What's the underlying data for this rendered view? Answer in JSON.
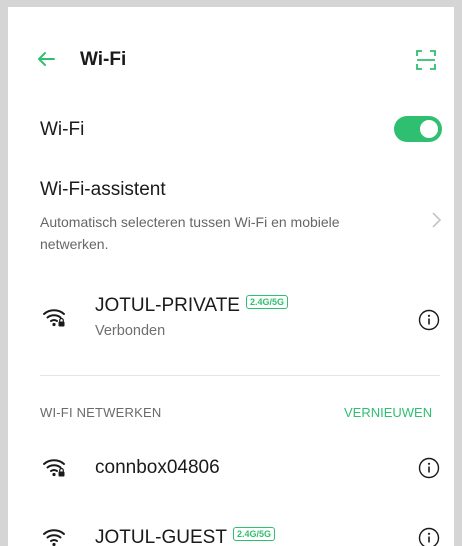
{
  "header": {
    "title": "Wi-Fi",
    "back_icon": "arrow-left-icon",
    "scan_icon": "qr-scan-icon"
  },
  "wifi_toggle": {
    "label": "Wi-Fi",
    "enabled": true
  },
  "assistant": {
    "title": "Wi-Fi-assistent",
    "description_line1": "Automatisch selecteren tussen Wi-Fi en mobiele",
    "description_line2": "netwerken."
  },
  "connected": {
    "ssid": "JOTUL-PRIVATE",
    "band": "2.4G/5G",
    "status": "Verbonden"
  },
  "networks_section": {
    "label": "WI-FI NETWERKEN",
    "refresh_label": "VERNIEUWEN",
    "items": [
      {
        "ssid": "connbox04806",
        "band": ""
      },
      {
        "ssid": "JOTUL-GUEST",
        "band": "2.4G/5G"
      }
    ]
  },
  "colors": {
    "accent": "#2fbf71",
    "background": "#ffffff",
    "frame": "#d5d5d5"
  }
}
